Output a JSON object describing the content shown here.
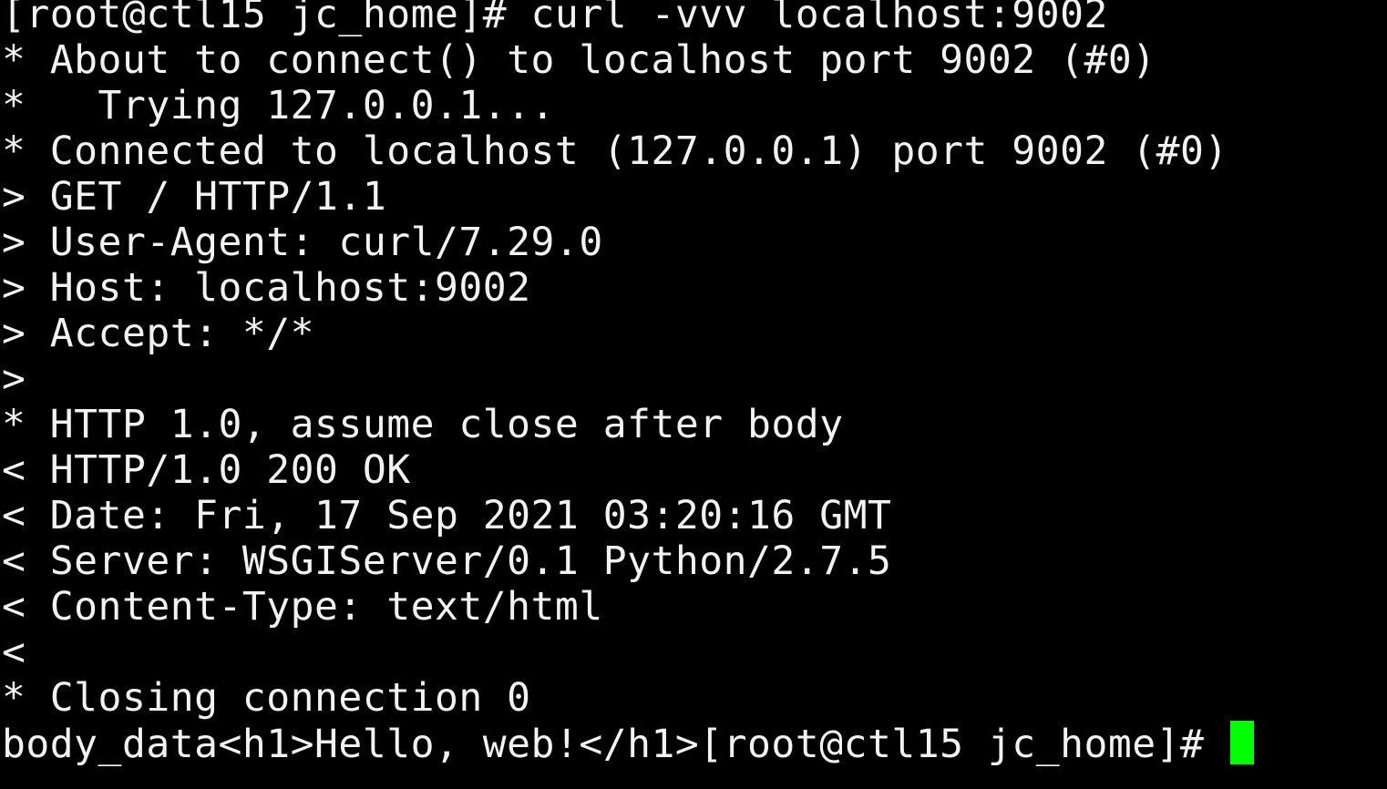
{
  "terminal": {
    "lines": [
      "[root@ctl15 jc_home]# curl -vvv localhost:9002",
      "* About to connect() to localhost port 9002 (#0)",
      "*   Trying 127.0.0.1...",
      "* Connected to localhost (127.0.0.1) port 9002 (#0)",
      "> GET / HTTP/1.1",
      "> User-Agent: curl/7.29.0",
      "> Host: localhost:9002",
      "> Accept: */*",
      ">",
      "* HTTP 1.0, assume close after body",
      "< HTTP/1.0 200 OK",
      "< Date: Fri, 17 Sep 2021 03:20:16 GMT",
      "< Server: WSGIServer/0.1 Python/2.7.5",
      "< Content-Type: text/html",
      "<",
      "* Closing connection 0"
    ],
    "last_line": "body_data<h1>Hello, web!</h1>[root@ctl15 jc_home]# ",
    "cursor_color": "#00ff00",
    "background_color": "#000000",
    "text_color": "#f2f2f2"
  }
}
